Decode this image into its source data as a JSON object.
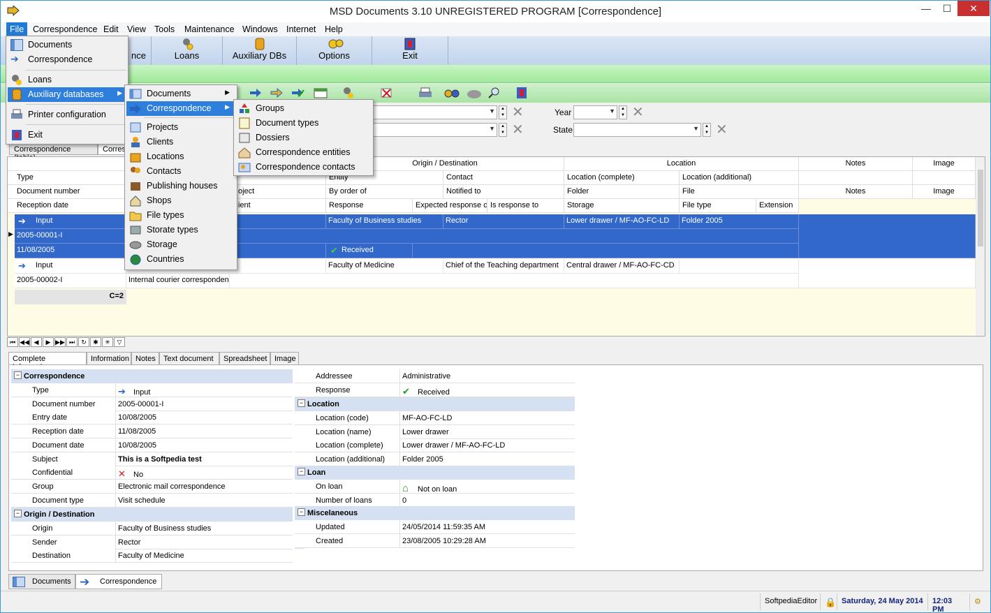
{
  "window": {
    "title": "MSD Documents 3.10 UNREGISTERED PROGRAM [Correspondence]",
    "min": "—",
    "max": "☐",
    "close": "✕"
  },
  "menubar": [
    "File",
    "Correspondence",
    "Edit",
    "View",
    "Tools",
    "Maintenance",
    "Windows",
    "Internet",
    "Help"
  ],
  "toolbar_big": [
    "nce",
    "Loans",
    "Auxiliary DBs",
    "Options",
    "Exit"
  ],
  "filters": {
    "year_label": "Year",
    "state_label": "State"
  },
  "grid_tabs": [
    "Correspondence (table)",
    "Corres"
  ],
  "grid": {
    "group_headers": {
      "origin": "Origin / Destination",
      "location": "Location",
      "notes": "Notes",
      "image": "Image"
    },
    "hdr_row1": {
      "type": "Type",
      "entity": "Entity",
      "contact": "Contact",
      "loc_complete": "Location (complete)",
      "loc_additional": "Location (additional)"
    },
    "hdr_row2": {
      "docnum": "Document number",
      "project": "oject",
      "order": "By order of",
      "notified": "Notified to",
      "folder": "Folder",
      "file": "File",
      "notes": "Notes",
      "image": "Image"
    },
    "hdr_row3": {
      "reception": "Reception date",
      "client": "ient",
      "response": "Response",
      "expected": "Expected response c",
      "isresp": "Is response to",
      "storage": "Storage",
      "filetype": "File type",
      "extension": "Extension"
    },
    "row1": {
      "type": "Input",
      "docnum": "2005-00001-I",
      "date": "11/08/2005",
      "entity": "Faculty of Business studies",
      "contact": "Rector",
      "loc": "Lower drawer / MF-AO-FC-LD",
      "folder": "Folder 2005",
      "response": "Received"
    },
    "row2": {
      "type": "Input",
      "docnum": "2005-00002-I",
      "group": "Internal courier corresponden",
      "entity": "Faculty of Medicine",
      "contact": "Chief of the Teaching department",
      "loc": "Central drawer / MF-AO-FC-CD"
    },
    "count": "C=2"
  },
  "detail_tabs": [
    "Complete information",
    "Information",
    "Notes",
    "Text document",
    "Spreadsheet",
    "Image"
  ],
  "detail": {
    "correspondence_head": "Correspondence",
    "left": [
      {
        "k": "Type",
        "v": "Input"
      },
      {
        "k": "Document number",
        "v": "2005-00001-I"
      },
      {
        "k": "Entry date",
        "v": "10/08/2005"
      },
      {
        "k": "Reception date",
        "v": "11/08/2005"
      },
      {
        "k": "Document date",
        "v": "10/08/2005"
      },
      {
        "k": "Subject",
        "v": "This is a Softpedia test"
      },
      {
        "k": "Confidential",
        "v": "No"
      },
      {
        "k": "Group",
        "v": "Electronic mail correspondence"
      },
      {
        "k": "Document type",
        "v": "Visit schedule"
      }
    ],
    "origin_head": "Origin / Destination",
    "origin": [
      {
        "k": "Origin",
        "v": "Faculty of Business studies"
      },
      {
        "k": "Sender",
        "v": "Rector"
      },
      {
        "k": "Destination",
        "v": "Faculty of Medicine"
      }
    ],
    "right_top": [
      {
        "k": "Addressee",
        "v": "Administrative"
      },
      {
        "k": "Response",
        "v": "Received"
      }
    ],
    "location_head": "Location",
    "location": [
      {
        "k": "Location (code)",
        "v": "MF-AO-FC-LD"
      },
      {
        "k": "Location (name)",
        "v": "Lower drawer"
      },
      {
        "k": "Location (complete)",
        "v": "Lower drawer / MF-AO-FC-LD"
      },
      {
        "k": "Location (additional)",
        "v": "Folder 2005"
      }
    ],
    "loan_head": "Loan",
    "loan": [
      {
        "k": "On loan",
        "v": "Not on loan"
      },
      {
        "k": "Number of loans",
        "v": "0"
      }
    ],
    "misc_head": "Miscelaneous",
    "misc": [
      {
        "k": "Updated",
        "v": "24/05/2014 11:59:35 AM"
      },
      {
        "k": "Created",
        "v": "23/08/2005 10:29:28 AM"
      }
    ]
  },
  "bottom_tabs": [
    "Documents",
    "Correspondence"
  ],
  "status": {
    "user": "SoftpediaEditor",
    "date": "Saturday, 24 May 2014",
    "time": "12:03 PM"
  },
  "file_menu": [
    "Documents",
    "Correspondence",
    "Loans",
    "Auxiliary databases",
    "Printer configuration",
    "Exit"
  ],
  "aux_menu": [
    "Documents",
    "Correspondence",
    "Projects",
    "Clients",
    "Locations",
    "Contacts",
    "Publishing houses",
    "Shops",
    "File types",
    "Storate types",
    "Storage",
    "Countries"
  ],
  "corr_menu": [
    "Groups",
    "Document types",
    "Dossiers",
    "Correspondence entities",
    "Correspondence contacts"
  ]
}
